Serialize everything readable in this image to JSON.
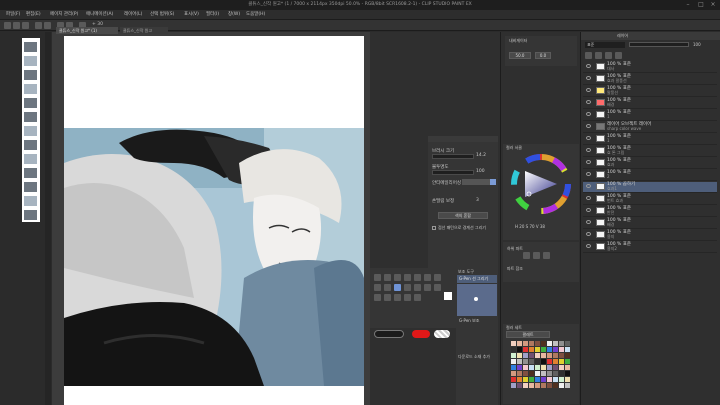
{
  "window": {
    "title": "클튜스_신작 원고* (1 / 7000 x 2114px 350dpi 50.0%  - RGB/8bit SCR1608.2-1) - CLIP STUDIO PAINT EX",
    "controls": [
      "–",
      "□",
      "×"
    ]
  },
  "menu": [
    "파일(F)",
    "편집(E)",
    "페이지 관리(P)",
    "애니메이션(A)",
    "레이어(L)",
    "선택 범위(S)",
    "표시(V)",
    "필터(I)",
    "창(W)",
    "도움말(H)"
  ],
  "toolbar": {
    "zoom_readout": "+ 30"
  },
  "document_tabs": [
    "클튜스_신작 원고* (1)",
    "클튜스_신작 원고"
  ],
  "tool_property": {
    "brush_size_label": "브러시 크기",
    "brush_size_value": "14.2",
    "opacity_label": "불투명도",
    "opacity_value": "100",
    "antialias_label": "안티에일리어싱",
    "stabilization_label": "손떨림 보정",
    "stabilization_value": "3",
    "fill_label": "색의 혼합",
    "checkbox_label": "점선 패턴으로 경계선 그리기"
  },
  "sub_tool": {
    "header": "보조 도구",
    "items": [
      "G-Pen 선 그리기",
      "G-Pen 보조"
    ],
    "add_label": "다운로드 소재 추가"
  },
  "navigator": {
    "header": "내비게이터",
    "zoom_value": "50.0",
    "rotate_value": "0.0"
  },
  "color_wheel": {
    "header": "컬러 서클",
    "hsv": "H 20  S 70  V 38"
  },
  "layer_property": {
    "blend_label": "하위 파트",
    "label2": "파트 참조"
  },
  "color_set": {
    "header": "컬러 세트",
    "rows": [
      "기본 컬러 세트",
      "커스텀"
    ],
    "label": "팔레트"
  },
  "layer_panel": {
    "tab_label": "레이어",
    "opacity_value": "100",
    "blend_mode": "표준",
    "layers": [
      {
        "name": "100 % 표준",
        "sub": "대사",
        "thumb": "#f5f5f5"
      },
      {
        "name": "100 % 표준",
        "sub": "효과 말풍선",
        "thumb": "#f5f5f5"
      },
      {
        "name": "100 % 표준",
        "sub": "말풍선",
        "thumb": "#ffe87a"
      },
      {
        "name": "100 % 표준",
        "sub": "배경",
        "thumb": "#ff6b6b"
      },
      {
        "name": "100 % 표준",
        "sub": "1",
        "thumb": "#f5f5f5"
      },
      {
        "name": "레이어 오브젝트 레이어",
        "sub": "sharp color wave",
        "thumb": "#777"
      },
      {
        "name": "100 % 표준",
        "sub": "1",
        "thumb": "#f5f5f5"
      },
      {
        "name": "100 % 표준",
        "sub": "효 톤 그림",
        "thumb": "#f5f5f5"
      },
      {
        "name": "100 % 표준",
        "sub": "효과",
        "thumb": "#f5f5f5"
      },
      {
        "name": "100 % 표준",
        "sub": "2",
        "thumb": "#f5f5f5"
      },
      {
        "name": "100 % 곱하기",
        "sub": "효과1",
        "thumb": "#f5f5f5"
      },
      {
        "name": "100 % 표준",
        "sub": "번트 효과",
        "thumb": "#f5f5f5"
      },
      {
        "name": "100 % 표준",
        "sub": "반전",
        "thumb": "#f5f5f5"
      },
      {
        "name": "100 % 표준",
        "sub": "배경",
        "thumb": "#f5f5f5"
      },
      {
        "name": "100 % 표준",
        "sub": "용지",
        "thumb": "#f5f5f5"
      },
      {
        "name": "100 % 표준",
        "sub": "용지2",
        "thumb": "#ffffff"
      }
    ]
  },
  "current_colors": {
    "main": "#ffffff",
    "sub": "#1b1b1b",
    "accent": "#e01818"
  },
  "canvas_status": {
    "zoom": "50.0"
  },
  "colors": {
    "accent_selection": "#4e5e7a",
    "wheel_marker": "#3b3b8f"
  }
}
